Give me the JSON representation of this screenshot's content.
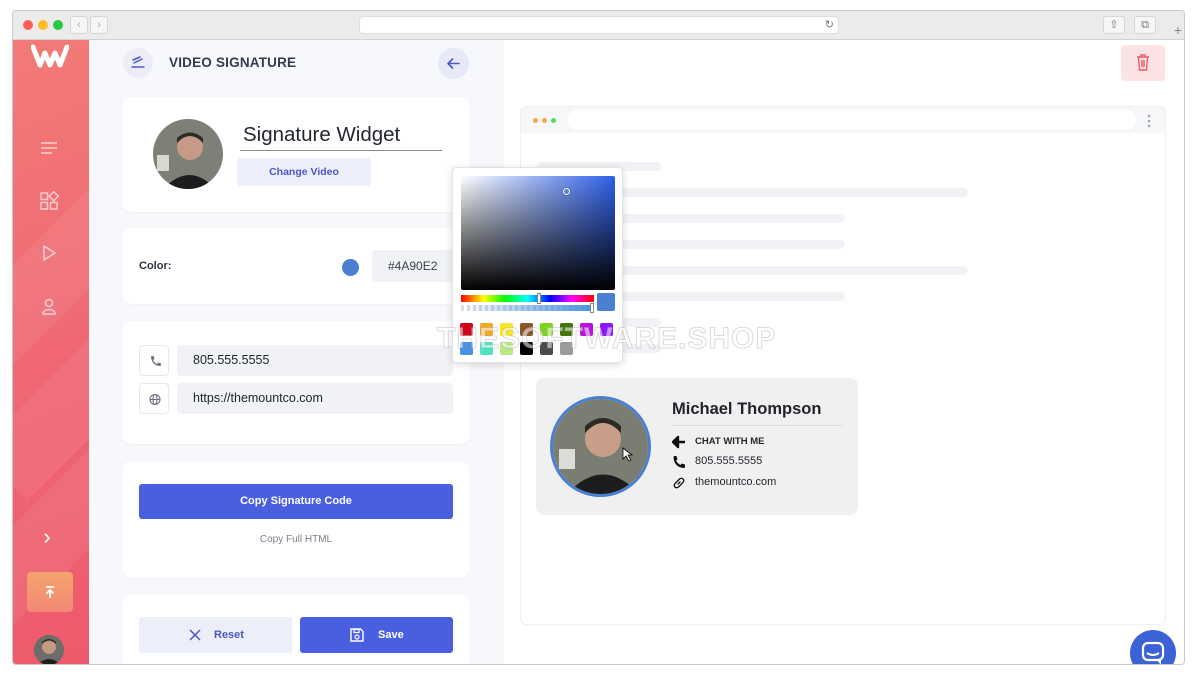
{
  "app": {
    "accent": "#4a5ee0",
    "sidebar_gradient": [
      "#f27b76",
      "#ed5a6c"
    ]
  },
  "header": {
    "title": "VIDEO SIGNATURE",
    "back_icon": "arrow-left-icon"
  },
  "widget": {
    "name": "Signature Widget",
    "change_video_label": "Change Video"
  },
  "color": {
    "label": "Color:",
    "value": "#4A90E2",
    "swatch": "#4a7fd2"
  },
  "contact": {
    "phone": "805.555.5555",
    "website": "https://themountco.com"
  },
  "actions": {
    "copy_code_label": "Copy Signature Code",
    "copy_html_label": "Copy Full HTML",
    "reset_label": "Reset",
    "save_label": "Save"
  },
  "color_picker": {
    "selected": "#4a7fd2",
    "swatches_row1": [
      "#d0021b",
      "#f5a623",
      "#f8e71c",
      "#8b572a",
      "#7ed321",
      "#417505",
      "#bd10e0",
      "#9013fe"
    ],
    "swatches_row2": [
      "#4a90e2",
      "#50e3c2",
      "#b8e986",
      "#000000",
      "#4a4a4a",
      "#9b9b9b"
    ]
  },
  "signature_preview": {
    "name": "Michael Thompson",
    "chat_label": "CHAT WITH ME",
    "phone": "805.555.5555",
    "website": "themountco.com"
  },
  "watermark": "THESOFTWARE.SHOP"
}
